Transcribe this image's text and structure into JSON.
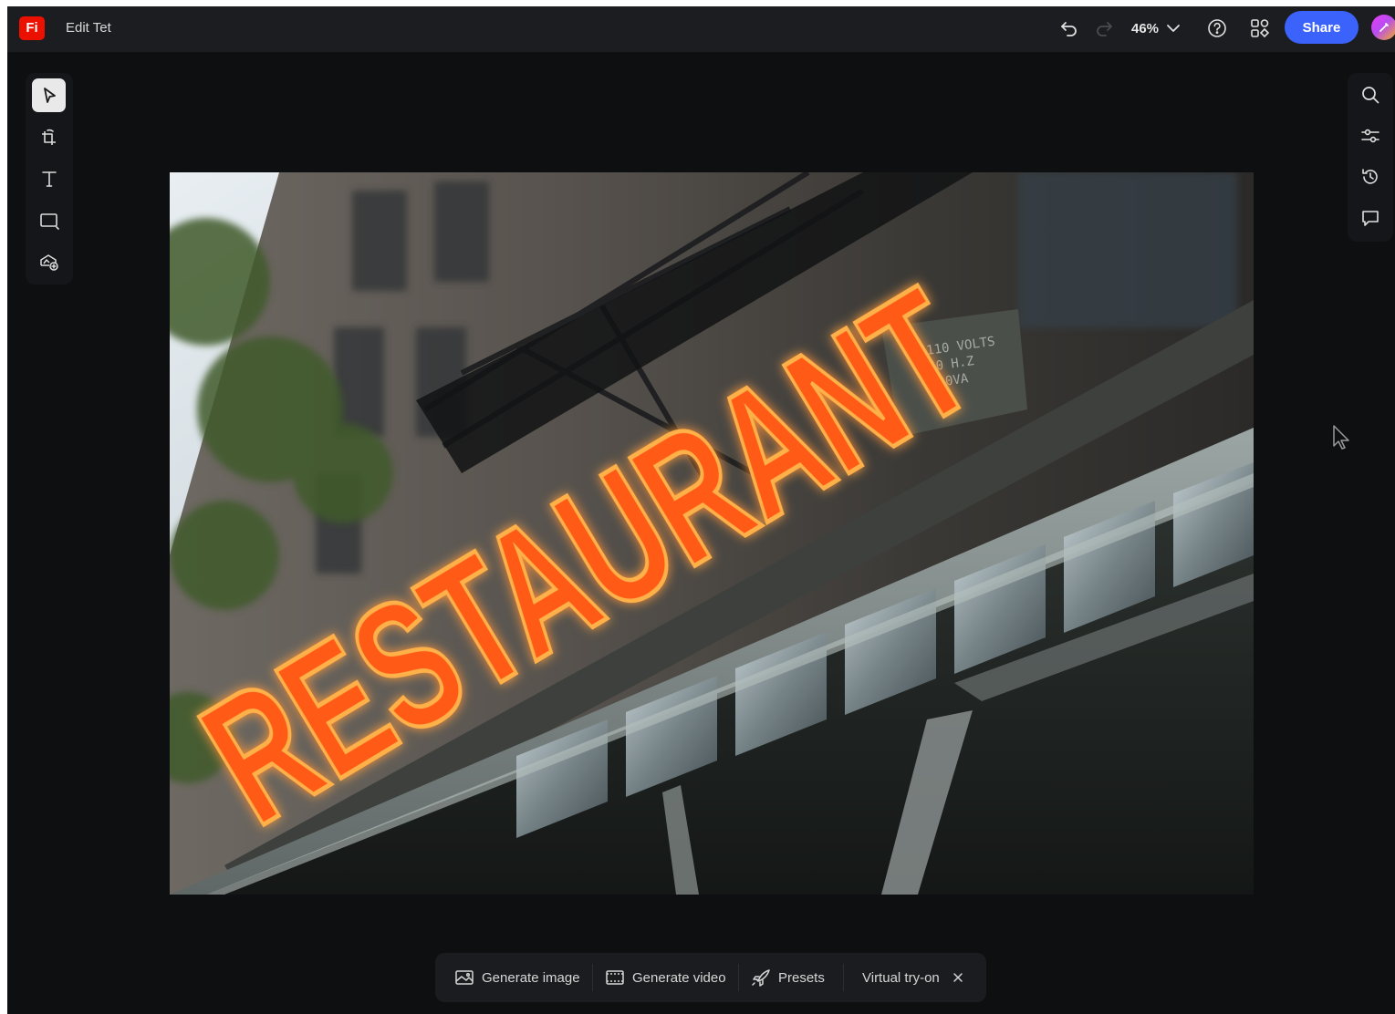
{
  "app": {
    "logo_text": "Fi",
    "document_title": "Edit Tet",
    "brand_color": "#eb1000",
    "accent_color": "#3b63fb"
  },
  "topbar": {
    "undo_icon": "undo-icon",
    "redo_icon": "redo-icon",
    "zoom_level": "46%",
    "help_icon": "help-icon",
    "apps_icon": "apps-icon",
    "share_label": "Share",
    "avatar_icon": "avatar"
  },
  "left_toolbar": {
    "tools": [
      {
        "icon": "select-arrow-icon",
        "active": true
      },
      {
        "icon": "crop-rotate-icon",
        "active": false
      },
      {
        "icon": "text-icon",
        "active": false
      },
      {
        "icon": "rectangle-shape-icon",
        "active": false
      },
      {
        "icon": "generative-fill-icon",
        "active": false
      }
    ]
  },
  "right_toolbar": {
    "tools": [
      "search-icon",
      "adjustments-icon",
      "history-icon",
      "comment-icon"
    ]
  },
  "canvas": {
    "image_subject": "neon-restaurant-sign",
    "neon_text": "RESTAURANT"
  },
  "action_bar": {
    "generate_image": "Generate image",
    "generate_video": "Generate video",
    "presets": "Presets",
    "virtual_tryon": "Virtual try-on"
  }
}
